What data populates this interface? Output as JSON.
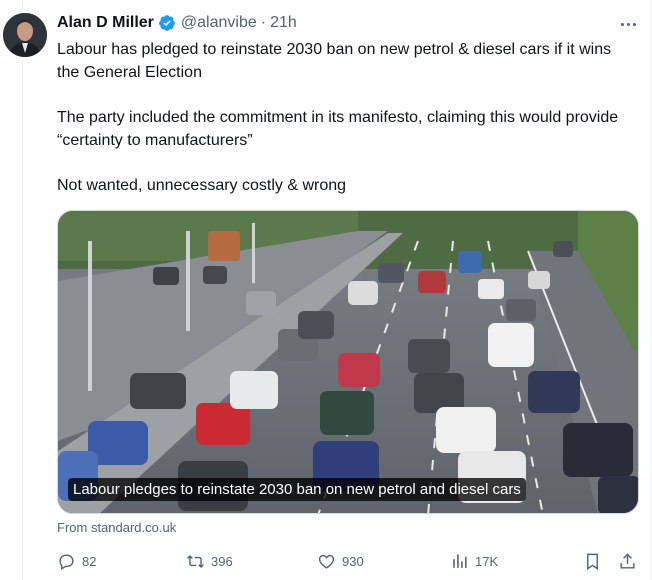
{
  "author": {
    "display_name": "Alan D Miller",
    "handle": "@alanvibe",
    "separator": "·",
    "timestamp": "21h"
  },
  "tweet": {
    "paragraphs": [
      "Labour has pledged to reinstate 2030 ban on new petrol & diesel cars if it wins the General Election",
      "The party included the commitment in its manifesto, claiming this would provide “certainty to manufacturers”",
      "Not wanted, unnecessary costly & wrong"
    ]
  },
  "media": {
    "caption": "Labour pledges to reinstate 2030 ban on new petrol and diesel cars"
  },
  "link_card": {
    "source": "From standard.co.uk"
  },
  "actions": {
    "replies": "82",
    "reposts": "396",
    "likes": "930",
    "views": "17K"
  },
  "colors": {
    "text_primary": "#0f1419",
    "text_secondary": "#536471",
    "verified_blue": "#1d9bf0",
    "border": "#cfd9de"
  },
  "icons": [
    "verified-badge-icon",
    "more-icon",
    "reply-icon",
    "repost-icon",
    "like-icon",
    "views-icon",
    "bookmark-icon",
    "share-icon"
  ]
}
